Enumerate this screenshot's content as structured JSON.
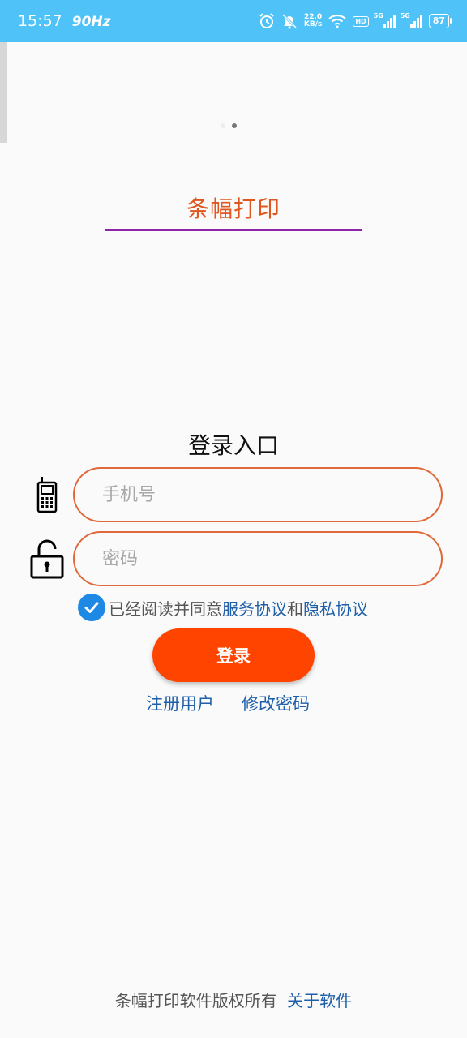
{
  "status_bar": {
    "time": "15:57",
    "refresh_rate": "90Hz",
    "net_speed_value": "22.0",
    "net_speed_unit": "KB/s",
    "hd_badge": "HD",
    "signal1_label": "5G",
    "signal2_label": "5G",
    "battery": "87"
  },
  "app": {
    "title": "条幅打印",
    "title_color": "#e0561f",
    "underline_color": "#8e24aa"
  },
  "login": {
    "heading": "登录入口",
    "phone_placeholder": "手机号",
    "password_placeholder": "密码",
    "agreement_prefix": "已经阅读并同意",
    "service_agreement": "服务协议",
    "agreement_and": "和",
    "privacy_agreement": "隐私协议",
    "login_label": "登录",
    "register_label": "注册用户",
    "change_password_label": "修改密码",
    "button_color": "#ff4400",
    "link_color": "#1f5fa8"
  },
  "footer": {
    "copyright": "条幅打印软件版权所有",
    "about_label": "关于软件"
  },
  "icons": [
    "alarm-icon",
    "mute-icon",
    "wifi-icon",
    "signal-icon",
    "battery-icon",
    "phone-icon",
    "unlock-icon",
    "check-icon"
  ]
}
